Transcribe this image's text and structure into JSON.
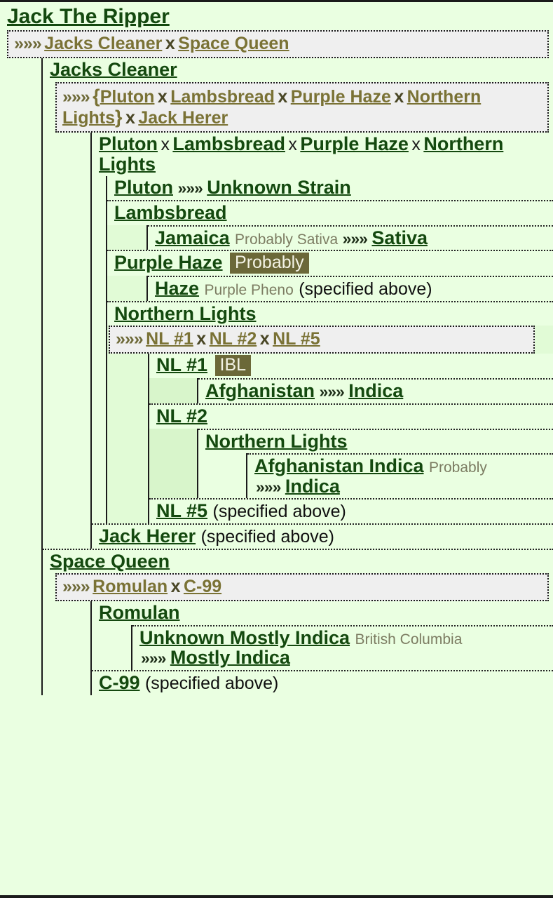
{
  "glyphs": {
    "arrows": "»»»",
    "cross": "x",
    "brace_open": "{",
    "brace_close": "}"
  },
  "colors": {
    "page_bg": "#eaffe1",
    "cross_row_bg": "#efefef",
    "link": "#14490f",
    "cross_link": "#7a7235",
    "badge_bg": "#6b6838",
    "badge_text": "#f3f3e4",
    "annotation": "#7c7c62",
    "guide_line": "#1b1b1b"
  },
  "labels": {
    "specified_above": "(specified above)"
  },
  "root": {
    "name": "Jack The Ripper"
  },
  "cross_rows": {
    "root": {
      "arrows": "»»»",
      "parents": [
        "Jacks Cleaner",
        "Space Queen"
      ]
    },
    "jacks_cleaner": {
      "arrows": "»»»",
      "text_parts": [
        "{",
        "Pluton",
        " x ",
        "Lambsbread",
        " x ",
        "Purple Haze",
        " x ",
        "Northern Lights",
        "}",
        " x ",
        "Jack Herer"
      ],
      "group": [
        "Pluton",
        "Lambsbread",
        "Purple Haze",
        "Northern Lights"
      ],
      "outer": [
        "Jack Herer"
      ]
    },
    "northern_lights": {
      "arrows": "»»»",
      "parents": [
        "NL #1",
        "NL #2",
        "NL #5"
      ]
    },
    "space_queen": {
      "arrows": "»»»",
      "parents": [
        "Romulan",
        "C-99"
      ]
    }
  },
  "nodes": {
    "jacks_cleaner": {
      "name": "Jacks Cleaner"
    },
    "pluton_group": {
      "parts": [
        "Pluton",
        " x ",
        "Lambsbread",
        " x ",
        "Purple Haze",
        " x ",
        "Northern Lights"
      ],
      "names": [
        "Pluton",
        "Lambsbread",
        "Purple Haze",
        "Northern Lights"
      ]
    },
    "pluton": {
      "name": "Pluton",
      "arrows": "»»»",
      "origin": "Unknown Strain"
    },
    "lambsbread": {
      "name": "Lambsbread"
    },
    "jamaica": {
      "name": "Jamaica",
      "annotation": "Probably Sativa",
      "arrows": "»»»",
      "origin": "Sativa"
    },
    "purple_haze": {
      "name": "Purple Haze",
      "badge": "Probably"
    },
    "haze": {
      "name": "Haze",
      "annotation": "Purple Pheno",
      "note": "(specified above)"
    },
    "northern_lights": {
      "name": "Northern Lights"
    },
    "nl1": {
      "name": "NL #1",
      "badge": "IBL"
    },
    "afghanistan": {
      "name": "Afghanistan",
      "arrows": "»»»",
      "origin": "Indica"
    },
    "nl2": {
      "name": "NL #2"
    },
    "nl2_northern_lights": {
      "name": "Northern Lights"
    },
    "afghanistan_indica": {
      "name": "Afghanistan Indica",
      "annotation": "Probably",
      "arrows": "»»»",
      "origin": "Indica"
    },
    "nl5": {
      "name": "NL #5",
      "note": "(specified above)"
    },
    "jack_herer": {
      "name": "Jack Herer",
      "note": "(specified above)"
    },
    "space_queen": {
      "name": "Space Queen"
    },
    "romulan": {
      "name": "Romulan"
    },
    "unknown_mostly_indica": {
      "name": "Unknown Mostly Indica",
      "annotation": "British Columbia",
      "arrows": "»»»",
      "origin": "Mostly Indica"
    },
    "c99": {
      "name": "C-99",
      "note": "(specified above)"
    }
  }
}
